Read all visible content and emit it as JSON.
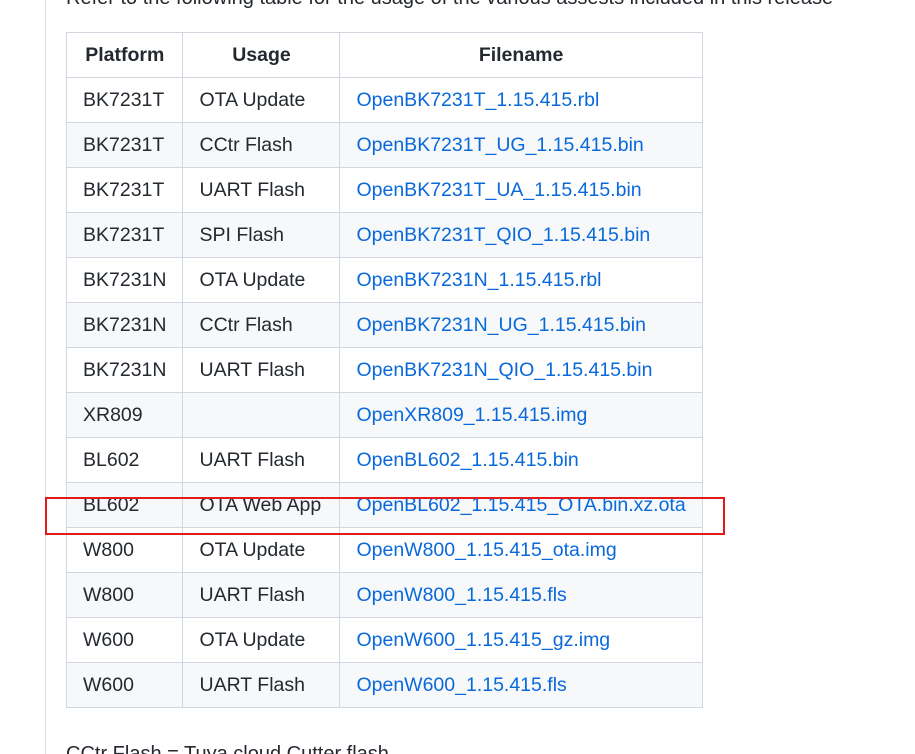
{
  "intro": "Refer to the following table for the usage of the various assests included in this release",
  "table": {
    "headers": [
      "Platform",
      "Usage",
      "Filename"
    ],
    "rows": [
      [
        "BK7231T",
        "OTA Update",
        "OpenBK7231T_1.15.415.rbl"
      ],
      [
        "BK7231T",
        "CCtr Flash",
        "OpenBK7231T_UG_1.15.415.bin"
      ],
      [
        "BK7231T",
        "UART Flash",
        "OpenBK7231T_UA_1.15.415.bin"
      ],
      [
        "BK7231T",
        "SPI Flash",
        "OpenBK7231T_QIO_1.15.415.bin"
      ],
      [
        "BK7231N",
        "OTA Update",
        "OpenBK7231N_1.15.415.rbl"
      ],
      [
        "BK7231N",
        "CCtr Flash",
        "OpenBK7231N_UG_1.15.415.bin"
      ],
      [
        "BK7231N",
        "UART Flash",
        "OpenBK7231N_QIO_1.15.415.bin"
      ],
      [
        "XR809",
        "",
        "OpenXR809_1.15.415.img"
      ],
      [
        "BL602",
        "UART Flash",
        "OpenBL602_1.15.415.bin"
      ],
      [
        "BL602",
        "OTA Web App",
        "OpenBL602_1.15.415_OTA.bin.xz.ota"
      ],
      [
        "W800",
        "OTA Update",
        "OpenW800_1.15.415_ota.img"
      ],
      [
        "W800",
        "UART Flash",
        "OpenW800_1.15.415.fls"
      ],
      [
        "W600",
        "OTA Update",
        "OpenW600_1.15.415_gz.img"
      ],
      [
        "W600",
        "UART Flash",
        "OpenW600_1.15.415.fls"
      ]
    ],
    "highlighted_row": 9
  },
  "footer": "CCtr Flash = Tuya cloud Cutter flash",
  "colors": {
    "link": "#0969da",
    "highlight": "#e31a1a",
    "border": "#d0d7de",
    "stripe": "#f6f8fa"
  }
}
